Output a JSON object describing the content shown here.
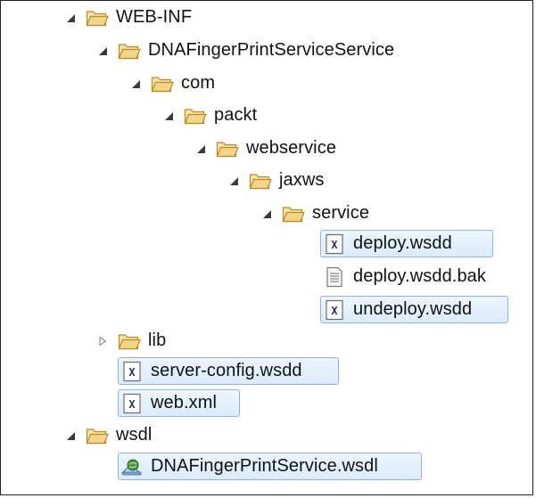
{
  "tree": {
    "items": [
      {
        "label": "WEB-INF",
        "kind": "folder",
        "twisty": "expanded",
        "selected": false
      },
      {
        "label": "DNAFingerPrintServiceService",
        "kind": "folder",
        "twisty": "expanded",
        "selected": false
      },
      {
        "label": "com",
        "kind": "folder",
        "twisty": "expanded",
        "selected": false
      },
      {
        "label": "packt",
        "kind": "folder",
        "twisty": "expanded",
        "selected": false
      },
      {
        "label": "webservice",
        "kind": "folder",
        "twisty": "expanded",
        "selected": false
      },
      {
        "label": "jaxws",
        "kind": "folder",
        "twisty": "expanded",
        "selected": false
      },
      {
        "label": "service",
        "kind": "folder",
        "twisty": "expanded",
        "selected": false
      },
      {
        "label": "deploy.wsdd",
        "kind": "xml-file",
        "twisty": "none",
        "selected": true
      },
      {
        "label": "deploy.wsdd.bak",
        "kind": "text-file",
        "twisty": "none",
        "selected": false
      },
      {
        "label": "undeploy.wsdd",
        "kind": "xml-file",
        "twisty": "none",
        "selected": true
      },
      {
        "label": "lib",
        "kind": "folder",
        "twisty": "collapsed",
        "selected": false
      },
      {
        "label": "server-config.wsdd",
        "kind": "xml-file",
        "twisty": "none",
        "selected": true
      },
      {
        "label": "web.xml",
        "kind": "xml-file",
        "twisty": "none",
        "selected": true
      },
      {
        "label": "wsdl",
        "kind": "folder",
        "twisty": "expanded",
        "selected": false
      },
      {
        "label": "DNAFingerPrintService.wsdl",
        "kind": "wsdl-file",
        "twisty": "none",
        "selected": true
      }
    ]
  },
  "icons": {
    "folder": "open-folder-icon",
    "xml-file": "xml-file-icon",
    "text-file": "text-file-icon",
    "wsdl-file": "wsdl-file-icon",
    "expanded": "expanded-twisty-icon",
    "collapsed": "collapsed-twisty-icon"
  },
  "colors": {
    "selection_border": "#8eb4e4",
    "selection_fill": "#dcebfb",
    "folder_fill": "#f3d58a",
    "folder_stroke": "#b88a28"
  }
}
